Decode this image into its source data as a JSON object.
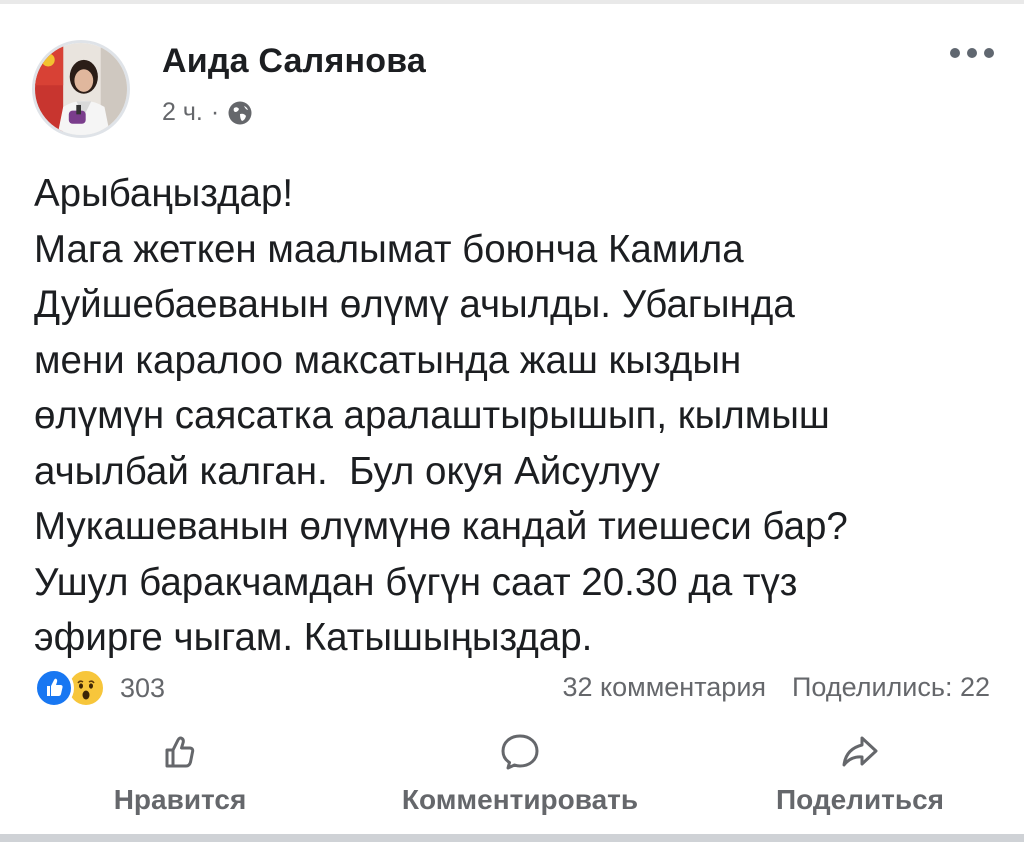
{
  "post": {
    "author": "Аида Салянова",
    "time": "2 ч.",
    "separator": "·",
    "text_lines": [
      "Арыбаңыздар!",
      "Мага жеткен маалымат боюнча Камила",
      "Дуйшебаеванын өлүмү ачылды. Убагында",
      "мени каралоо максатында жаш кыздын",
      "өлүмүн саясатка аралаштырышып, кылмыш",
      "ачылбай калган.  Бул окуя Айсулуу",
      "Мукашеванын өлүмүнө кандай тиешеси бар?",
      "Ушул баракчамдан бүгүн саат 20.30 да түз",
      "эфирге чыгам. Катышыңыздар."
    ]
  },
  "reactions": {
    "count": "303",
    "types": [
      "like-icon",
      "wow-icon"
    ]
  },
  "stats": {
    "comments": "32 комментария",
    "shares": "Поделились: 22"
  },
  "actions": {
    "like": "Нравится",
    "comment": "Комментировать",
    "share": "Поделиться"
  },
  "colors": {
    "text": "#1c1e21",
    "secondary": "#65676b",
    "like_blue": "#1877f2",
    "wow_yellow": "#f7c63b"
  }
}
